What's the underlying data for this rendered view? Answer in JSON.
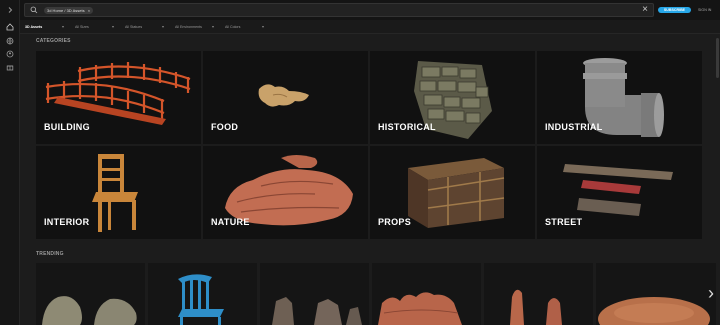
{
  "search": {
    "chip_label": "3d Home / 3D Assets",
    "chip_close": "×",
    "clear": "×"
  },
  "header": {
    "subscribe_label": "SUBSCRIBE",
    "signin_label": "SIGN IN"
  },
  "filters": [
    {
      "label": "3D Assets"
    },
    {
      "label": "All Sizes"
    },
    {
      "label": "All Statues"
    },
    {
      "label": "All Environments"
    },
    {
      "label": "All Colors"
    }
  ],
  "sidebar": {
    "items": [
      {
        "icon": "chevron-right-icon"
      },
      {
        "icon": "home-icon"
      },
      {
        "icon": "globe-icon"
      },
      {
        "icon": "user-icon"
      },
      {
        "icon": "gift-icon"
      }
    ]
  },
  "categories": {
    "title": "CATEGORIES",
    "items": [
      {
        "label": "BUILDING"
      },
      {
        "label": "FOOD"
      },
      {
        "label": "HISTORICAL"
      },
      {
        "label": "INDUSTRIAL"
      },
      {
        "label": "INTERIOR"
      },
      {
        "label": "NATURE"
      },
      {
        "label": "PROPS"
      },
      {
        "label": "STREET"
      }
    ]
  },
  "trending": {
    "title": "TRENDING",
    "next_arrow": "›"
  },
  "colors": {
    "accent": "#27a7e8",
    "background": "#1c1c1c"
  }
}
